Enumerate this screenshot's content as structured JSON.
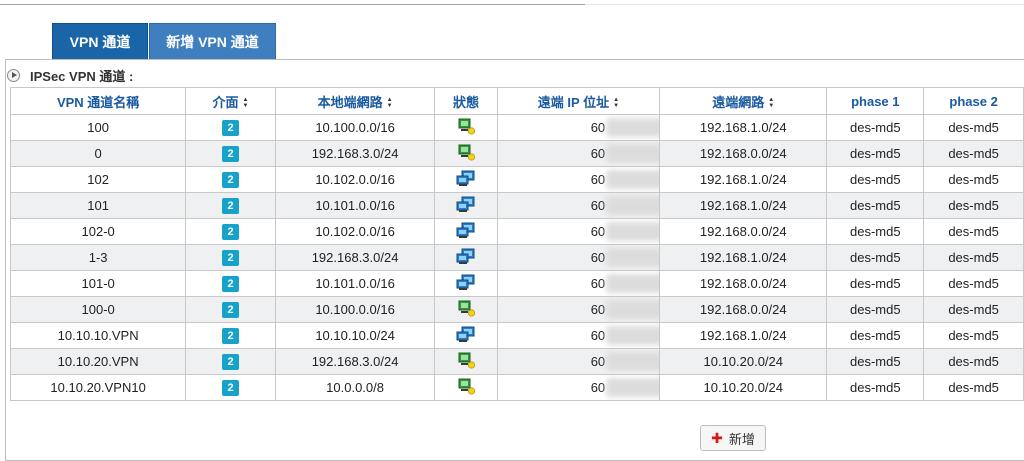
{
  "tabs": [
    {
      "label": "VPN 通道",
      "active": true
    },
    {
      "label": "新增 VPN 通道",
      "active": false
    }
  ],
  "section_title": "IPSec VPN 通道 :",
  "table": {
    "headers": [
      {
        "label": "VPN 通道名稱",
        "sortable": false
      },
      {
        "label": "介面",
        "sortable": true
      },
      {
        "label": "本地端網路",
        "sortable": true
      },
      {
        "label": "狀態",
        "sortable": false
      },
      {
        "label": "遠端 IP 位址",
        "sortable": true
      },
      {
        "label": "遠端網路",
        "sortable": true
      },
      {
        "label": "phase 1",
        "sortable": false
      },
      {
        "label": "phase 2",
        "sortable": false
      }
    ],
    "rows": [
      {
        "name": "100",
        "iface": "2",
        "local": "10.100.0.0/16",
        "status": "disconnected",
        "remote_ip": "60",
        "remote_net": "192.168.1.0/24",
        "p1": "des-md5",
        "p2": "des-md5"
      },
      {
        "name": "0",
        "iface": "2",
        "local": "192.168.3.0/24",
        "status": "disconnected",
        "remote_ip": "60",
        "remote_net": "192.168.0.0/24",
        "p1": "des-md5",
        "p2": "des-md5"
      },
      {
        "name": "102",
        "iface": "2",
        "local": "10.102.0.0/16",
        "status": "connected",
        "remote_ip": "60",
        "remote_net": "192.168.1.0/24",
        "p1": "des-md5",
        "p2": "des-md5"
      },
      {
        "name": "101",
        "iface": "2",
        "local": "10.101.0.0/16",
        "status": "connected",
        "remote_ip": "60",
        "remote_net": "192.168.1.0/24",
        "p1": "des-md5",
        "p2": "des-md5"
      },
      {
        "name": "102-0",
        "iface": "2",
        "local": "10.102.0.0/16",
        "status": "connected",
        "remote_ip": "60",
        "remote_net": "192.168.0.0/24",
        "p1": "des-md5",
        "p2": "des-md5"
      },
      {
        "name": "1-3",
        "iface": "2",
        "local": "192.168.3.0/24",
        "status": "connected",
        "remote_ip": "60",
        "remote_net": "192.168.1.0/24",
        "p1": "des-md5",
        "p2": "des-md5"
      },
      {
        "name": "101-0",
        "iface": "2",
        "local": "10.101.0.0/16",
        "status": "connected",
        "remote_ip": "60",
        "remote_net": "192.168.0.0/24",
        "p1": "des-md5",
        "p2": "des-md5"
      },
      {
        "name": "100-0",
        "iface": "2",
        "local": "10.100.0.0/16",
        "status": "disconnected",
        "remote_ip": "60",
        "remote_net": "192.168.0.0/24",
        "p1": "des-md5",
        "p2": "des-md5"
      },
      {
        "name": "10.10.10.VPN",
        "iface": "2",
        "local": "10.10.10.0/24",
        "status": "connected",
        "remote_ip": "60",
        "remote_net": "192.168.1.0/24",
        "p1": "des-md5",
        "p2": "des-md5"
      },
      {
        "name": "10.10.20.VPN",
        "iface": "2",
        "local": "192.168.3.0/24",
        "status": "disconnected",
        "remote_ip": "60",
        "remote_net": "10.10.20.0/24",
        "p1": "des-md5",
        "p2": "des-md5"
      },
      {
        "name": "10.10.20.VPN10",
        "iface": "2",
        "local": "10.0.0.0/8",
        "status": "disconnected",
        "remote_ip": "60",
        "remote_net": "10.10.20.0/24",
        "p1": "des-md5",
        "p2": "des-md5"
      }
    ]
  },
  "add_button_label": "新增",
  "colors": {
    "tab_active": "#1a64a8",
    "tab_inactive": "#3f7fc0",
    "header_text": "#1a5aa0",
    "badge": "#17a3c9",
    "row_alt": "#eef0f2",
    "add_plus": "#d01818"
  }
}
